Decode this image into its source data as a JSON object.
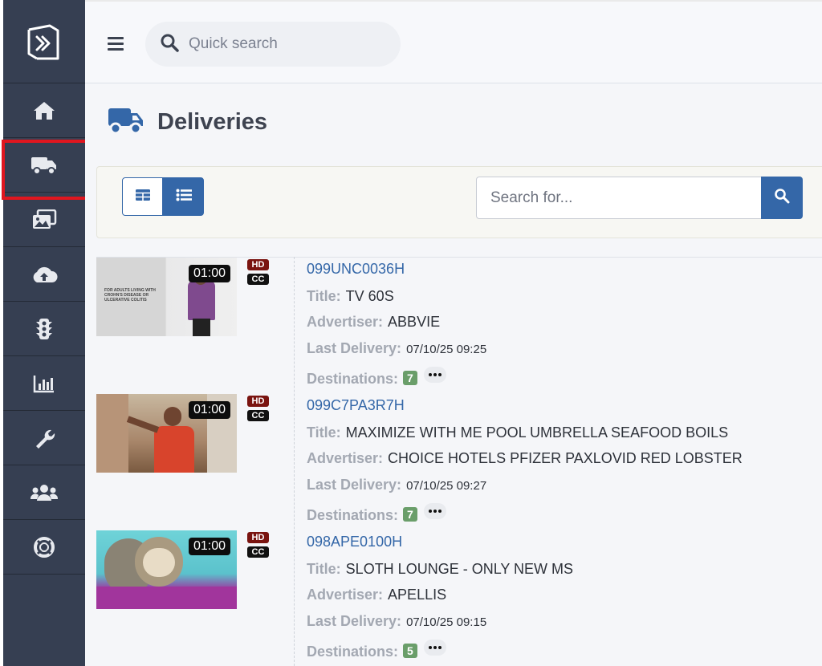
{
  "header": {
    "quick_search_placeholder": "Quick search"
  },
  "sidebar": {
    "items": [
      {
        "name": "home",
        "icon": "home-icon"
      },
      {
        "name": "deliveries",
        "icon": "truck-icon",
        "highlighted": true
      },
      {
        "name": "media",
        "icon": "images-icon"
      },
      {
        "name": "upload",
        "icon": "cloud-upload-icon"
      },
      {
        "name": "traffic",
        "icon": "traffic-light-icon"
      },
      {
        "name": "reports",
        "icon": "bar-chart-icon"
      },
      {
        "name": "tools",
        "icon": "wrench-icon"
      },
      {
        "name": "users",
        "icon": "users-icon"
      },
      {
        "name": "support",
        "icon": "life-ring-icon"
      }
    ],
    "highlight_color": "#e0161f",
    "background": "#363f52"
  },
  "page": {
    "title": "Deliveries",
    "search_placeholder": "Search for...",
    "accent": "#3467a8"
  },
  "labels": {
    "title": "Title:",
    "advertiser": "Advertiser:",
    "last_delivery": "Last Delivery:",
    "destinations": "Destinations:"
  },
  "deliveries": [
    {
      "id": "099UNC0036H",
      "duration": "01:00",
      "badges": [
        "HD",
        "CC"
      ],
      "title": "TV 60S",
      "advertiser": "ABBVIE",
      "last_delivery": "07/10/25 09:25",
      "destinations": "7",
      "thumb_text": "FOR ADULTS LIVING WITH CROHN'S DISEASE OR ULCERATIVE COLITIS"
    },
    {
      "id": "099C7PA3R7H",
      "duration": "01:00",
      "badges": [
        "HD",
        "CC"
      ],
      "title": "MAXIMIZE WITH ME POOL UMBRELLA SEAFOOD BOILS",
      "advertiser": "CHOICE HOTELS PFIZER PAXLOVID RED LOBSTER",
      "last_delivery": "07/10/25 09:27",
      "destinations": "7"
    },
    {
      "id": "098APE0100H",
      "duration": "01:00",
      "badges": [
        "HD",
        "CC"
      ],
      "title": "SLOTH LOUNGE - ONLY NEW MS",
      "advertiser": "APELLIS",
      "last_delivery": "07/10/25 09:15",
      "destinations": "5"
    }
  ]
}
